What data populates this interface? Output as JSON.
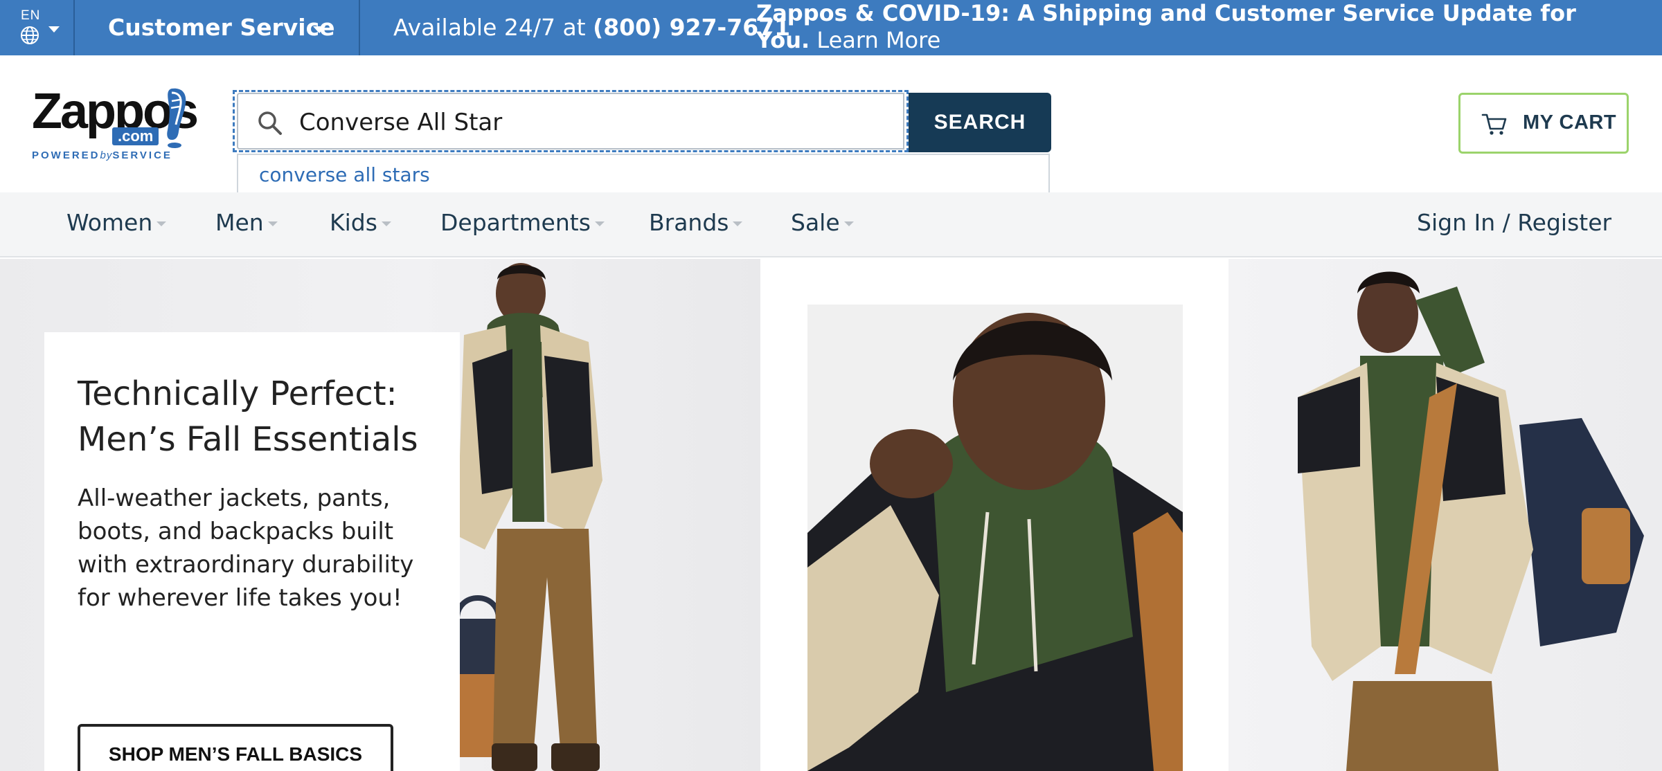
{
  "topbar": {
    "lang_code": "EN",
    "customer_service_label": "Customer Service",
    "availability_prefix": "Available 24/7 at",
    "phone": "(800) 927-7671",
    "covid_headline": "Zappos & COVID-19: A Shipping and Customer Service Update for You.",
    "covid_link": "Learn More",
    "bar_color": "#3d7bbf"
  },
  "header": {
    "logo": {
      "word": "Zappos",
      "com": ".com",
      "tag_powered": "POWERED",
      "tag_by": "by",
      "tag_service": "SERVICE"
    },
    "search": {
      "value": "Converse All Star",
      "button_label": "SEARCH",
      "icon": "search-icon",
      "suggestions": [
        "converse all stars"
      ]
    },
    "cart": {
      "label": "MY CART",
      "icon": "cart-icon",
      "border_color": "#9bd36b"
    }
  },
  "nav": {
    "items": [
      {
        "label": "Women"
      },
      {
        "label": "Men"
      },
      {
        "label": "Kids"
      },
      {
        "label": "Departments"
      },
      {
        "label": "Brands"
      },
      {
        "label": "Sale"
      }
    ],
    "account_label": "Sign In / Register"
  },
  "hero": {
    "title_line1": "Technically Perfect:",
    "title_line2": "Men’s Fall Essentials",
    "body": "All-weather jackets, pants, boots, and backpacks built with extraordinary durability for wherever life takes you!",
    "cta_label": "SHOP MEN’S FALL BASICS",
    "images": [
      "model-standing-full-body",
      "model-closeup-jacket",
      "model-with-backpack"
    ]
  }
}
